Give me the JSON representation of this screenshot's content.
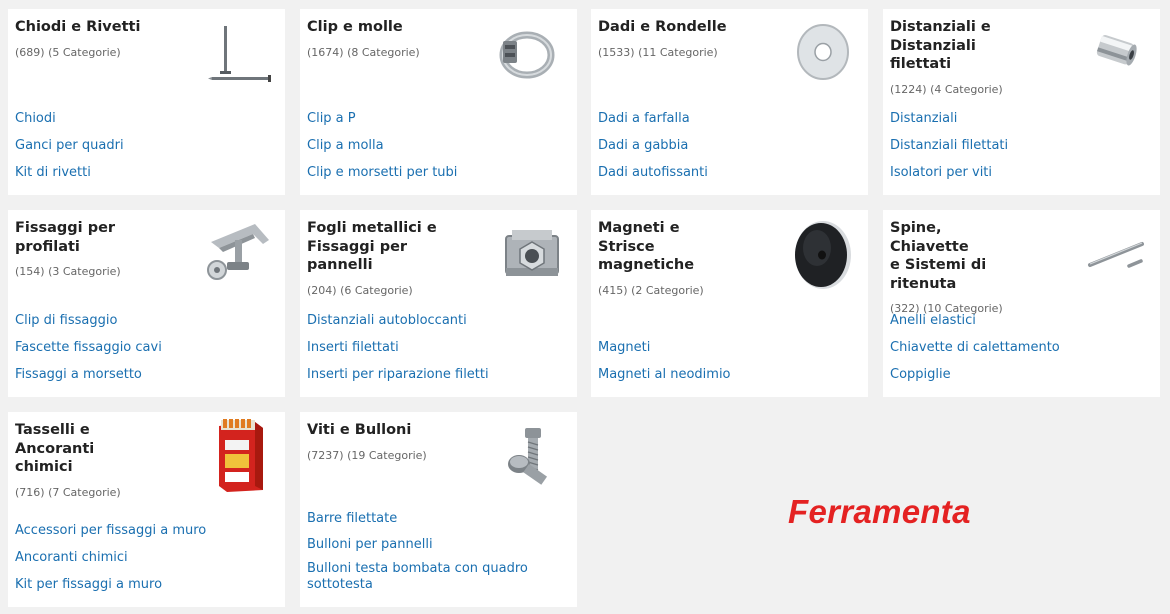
{
  "categories": [
    {
      "title": "Chiodi e Rivetti",
      "count": "(689) (5 Categorie)",
      "image": "nail-icon",
      "links": [
        "Chiodi",
        "Ganci per quadri",
        "Kit di rivetti"
      ]
    },
    {
      "title": "Clip e molle",
      "count": "(1674) (8 Categorie)",
      "image": "hose-clamp-icon",
      "links": [
        "Clip a P",
        "Clip a molla",
        "Clip e morsetti per tubi"
      ]
    },
    {
      "title": "Dadi e Rondelle",
      "count": "(1533) (11 Categorie)",
      "image": "washer-icon",
      "links": [
        "Dadi a farfalla",
        "Dadi a gabbia",
        "Dadi autofissanti"
      ]
    },
    {
      "title": "Distanziali e\nDistanziali\nfilettati",
      "count": "(1224) (4 Categorie)",
      "image": "spacer-icon",
      "links": [
        "Distanziali",
        "Distanziali filettati",
        "Isolatori per viti"
      ]
    },
    {
      "title": "Fissaggi per\nprofilati",
      "count": "(154) (3 Categorie)",
      "image": "beam-clamp-icon",
      "links": [
        "Clip di fissaggio",
        "Fascette fissaggio cavi",
        "Fissaggi a morsetto"
      ]
    },
    {
      "title": "Fogli metallici e\nFissaggi per\npannelli",
      "count": "(204) (6 Categorie)",
      "image": "cage-nut-icon",
      "links": [
        "Distanziali autobloccanti",
        "Inserti filettati",
        "Inserti per riparazione filetti"
      ]
    },
    {
      "title": "Magneti e\nStrisce\nmagnetiche",
      "count": "(415) (2 Categorie)",
      "image": "pot-magnet-icon",
      "links": [
        "Magneti",
        "Magneti al neodimio"
      ]
    },
    {
      "title": "Spine, Chiavette\ne Sistemi di\nritenuta",
      "count": "(322) (10 Categorie)",
      "image": "dowel-pins-icon",
      "links": [
        "Anelli elastici",
        "Chiavette di calettamento",
        "Coppiglie"
      ]
    },
    {
      "title": "Tasselli e\nAncoranti\nchimici",
      "count": "(716) (7 Categorie)",
      "image": "wall-plug-box-icon",
      "links": [
        "Accessori per fissaggi a muro",
        "Ancoranti chimici",
        "Kit per fissaggi a muro"
      ]
    },
    {
      "title": "Viti e Bulloni",
      "count": "(7237) (19 Categorie)",
      "image": "bolt-icon",
      "links": [
        "Barre filettate",
        "Bulloni per pannelli",
        "Bulloni testa bombata con quadro sottotesta"
      ]
    }
  ],
  "brand": {
    "text": "Ferramenta",
    "color": "#e42222"
  },
  "colors": {
    "link": "#1a6fb0",
    "background": "#f1f1f1",
    "card": "#ffffff"
  }
}
